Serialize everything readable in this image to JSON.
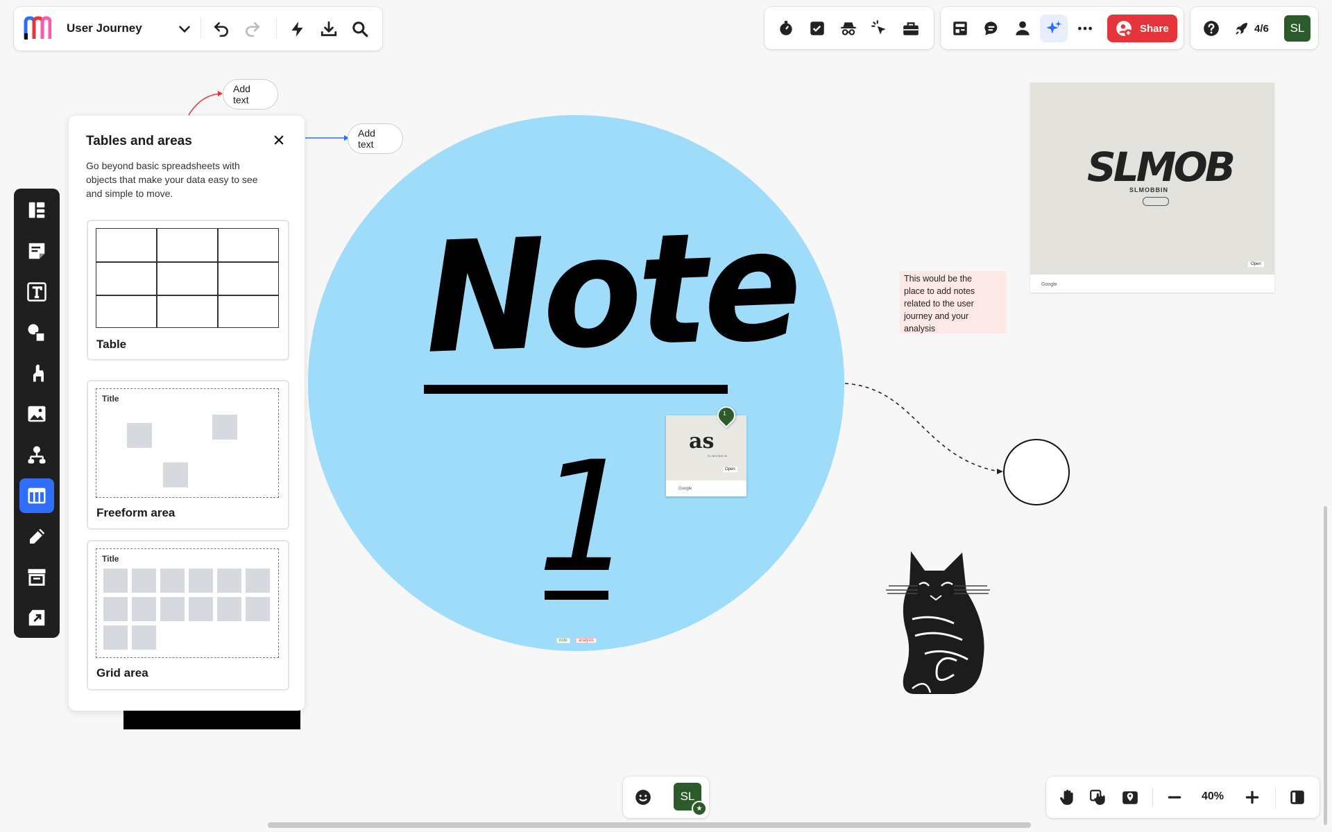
{
  "board": {
    "title": "User Journey"
  },
  "top_right": {
    "share_label": "Share",
    "progress_label": "4/6",
    "user_initials": "SL"
  },
  "colors": {
    "accent_blue": "#2f6ef7",
    "share_red": "#e5343a",
    "avatar_green": "#2d5a2b",
    "circle_blue": "#9fdcf9",
    "note_pink": "#fde8e8"
  },
  "tables_panel": {
    "title": "Tables and areas",
    "description": "Go beyond basic spreadsheets with objects that make your data easy to see and simple to move.",
    "cards": [
      {
        "label": "Table"
      },
      {
        "label": "Freeform area",
        "preview_title": "Title"
      },
      {
        "label": "Grid area",
        "preview_title": "Title"
      }
    ]
  },
  "canvas": {
    "add_text_1": "Add text",
    "add_text_2": "Add text",
    "big_circle_title": "Note",
    "big_circle_number": "1",
    "tag_1": "note",
    "tag_2": "analysis",
    "sticky_note_text": "This would be the place to add notes related to the user journey and your analysis",
    "image_card_1": {
      "logo_text": "SLMOB",
      "sub_text": "SLMOBBIN",
      "open_label": "Open",
      "source_label": "Google"
    },
    "image_card_2": {
      "logo_text": "as",
      "sub_text": "SLMOBBIN",
      "open_label": "Open",
      "source_label": "Google",
      "comment_count": "1"
    }
  },
  "bottom_bar": {
    "user_initials": "SL",
    "zoom_level": "40%"
  },
  "icons": {
    "top_left": [
      "app-logo-icon",
      "chevron-down-icon",
      "undo-icon",
      "redo-icon",
      "lightning-icon",
      "download-icon",
      "search-icon"
    ],
    "top_middle": [
      "timer-icon",
      "checkbox-icon",
      "spy-icon",
      "cursor-click-icon",
      "toolbox-icon"
    ],
    "top_right": [
      "layout-icon",
      "comment-icon",
      "person-icon",
      "sparkle-ai-icon",
      "more-icon",
      "share-person-icon",
      "help-icon",
      "rocket-icon"
    ],
    "left": [
      "templates-icon",
      "sticky-note-icon",
      "text-icon",
      "shapes-icon",
      "llama-icon",
      "image-icon",
      "diagram-icon",
      "table-icon",
      "pen-icon",
      "archive-icon",
      "export-icon"
    ],
    "bottom_right": [
      "hand-icon",
      "touch-icon",
      "map-pin-icon",
      "zoom-out-icon",
      "zoom-in-icon",
      "panel-toggle-icon"
    ]
  }
}
